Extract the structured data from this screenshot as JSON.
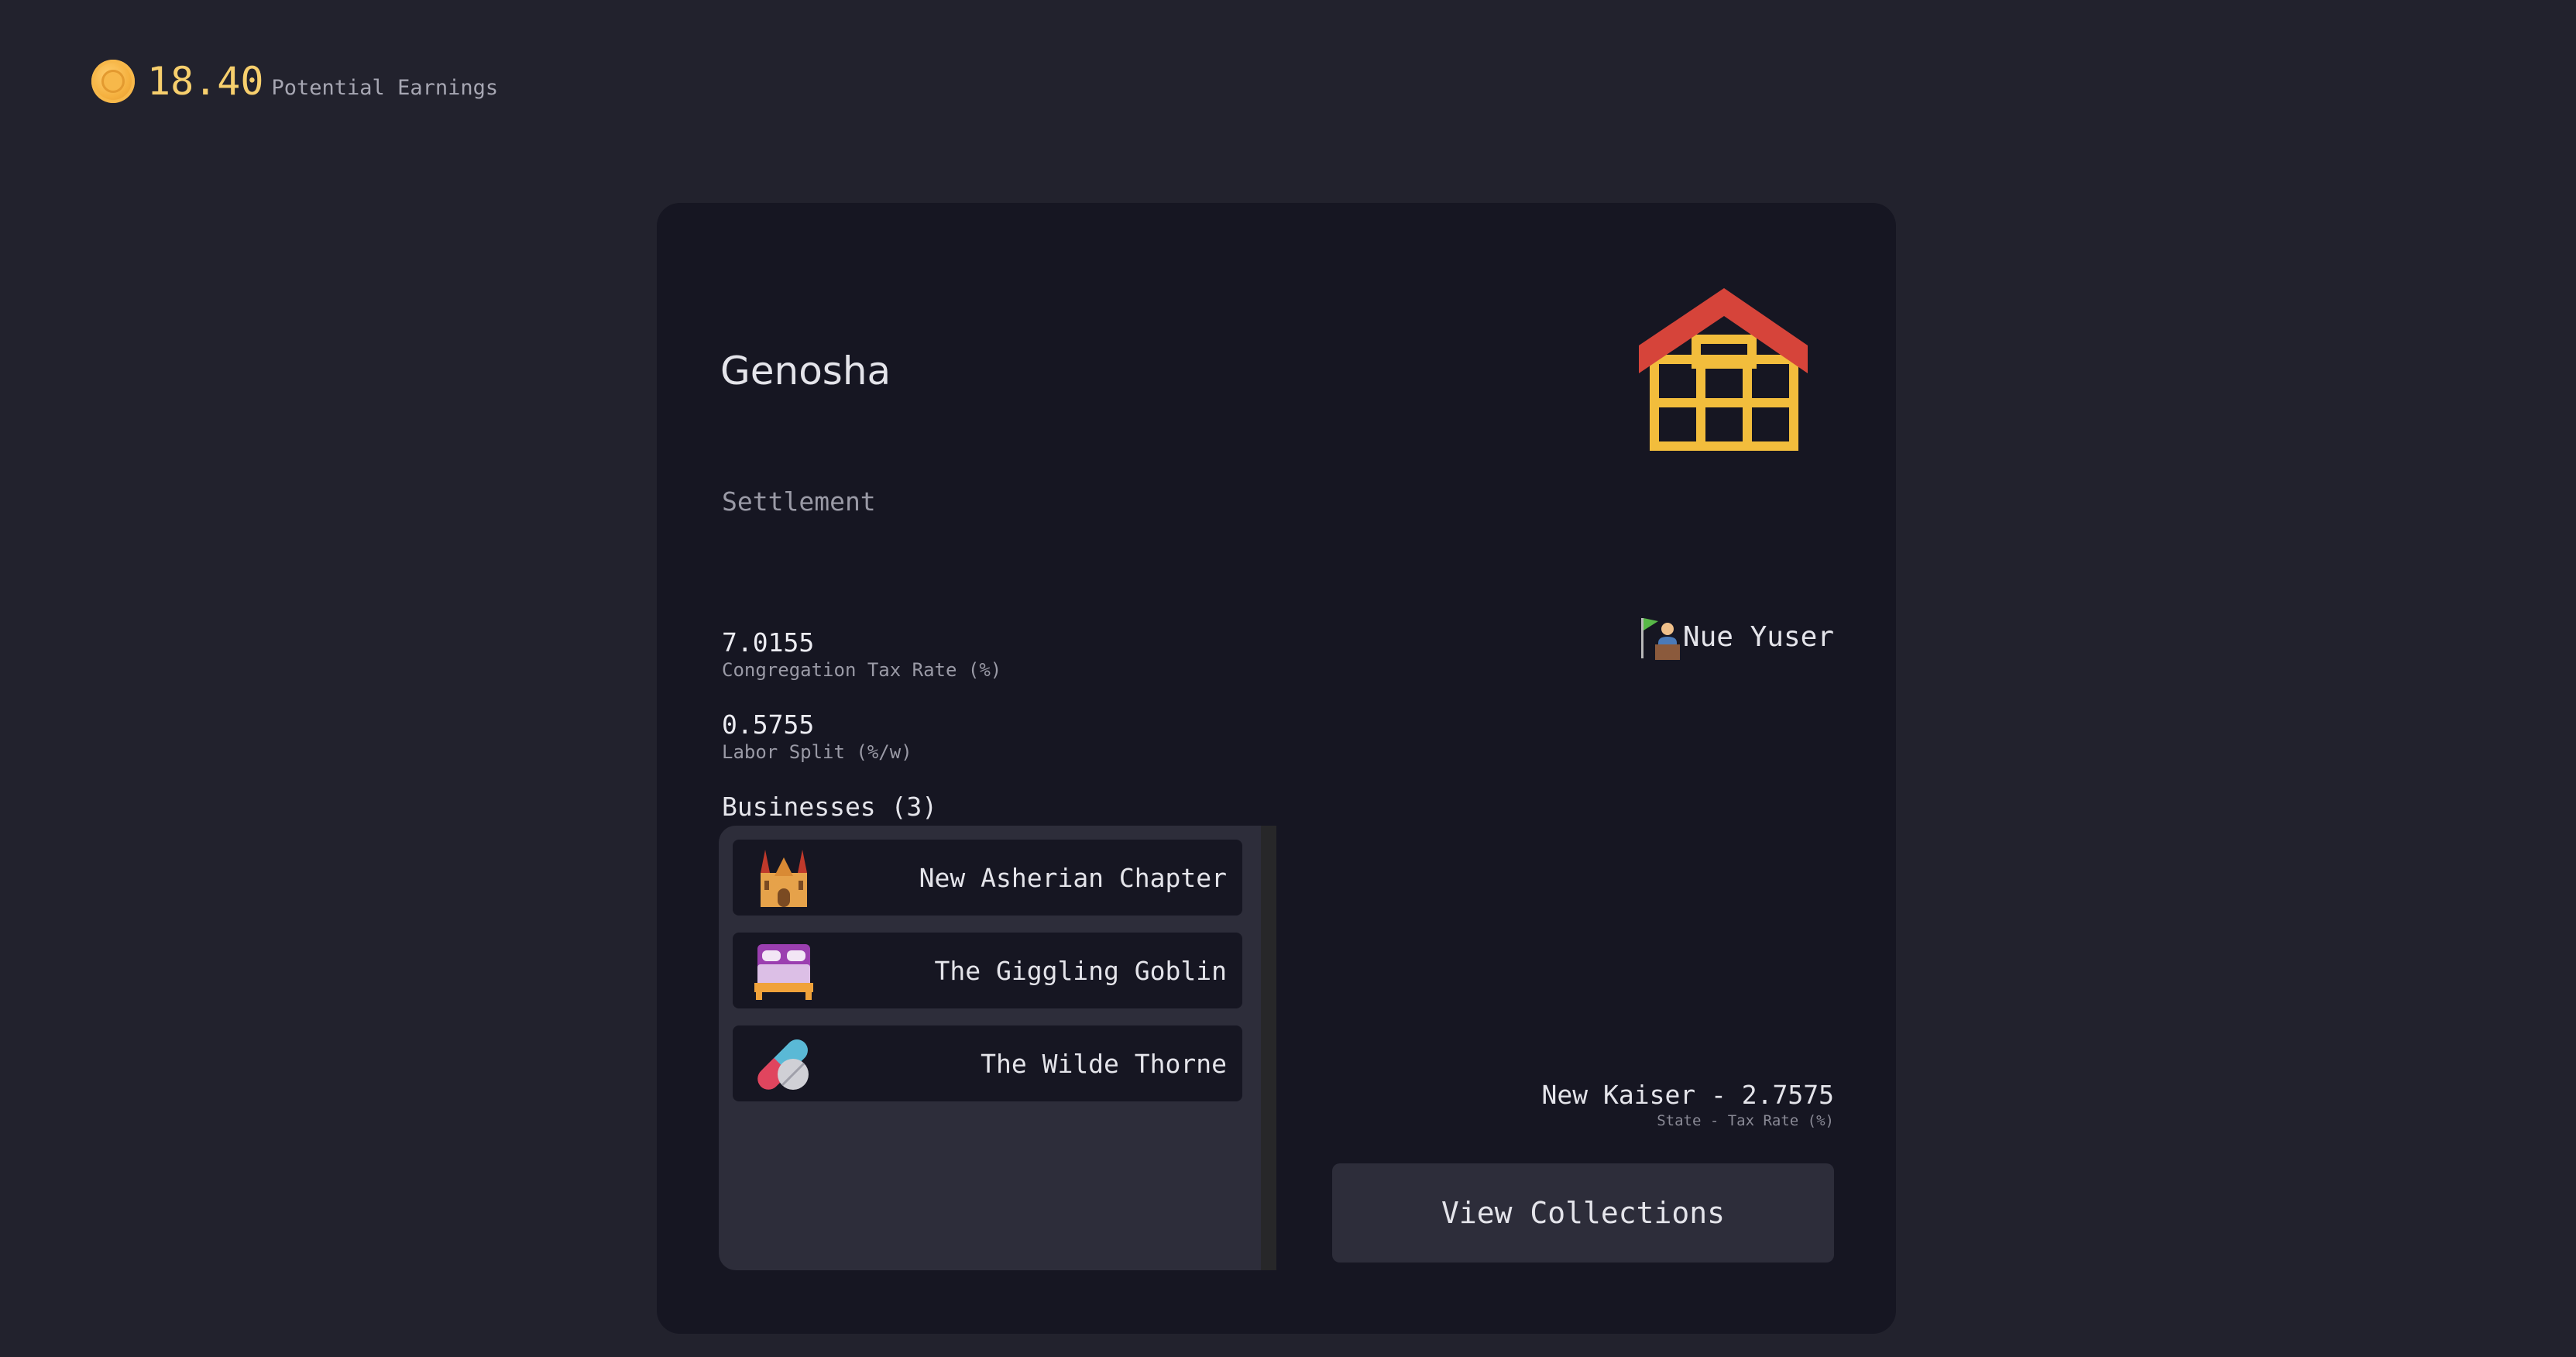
{
  "header": {
    "earnings_value": "18.40",
    "earnings_label": "Potential Earnings",
    "coin_icon": "coin-icon"
  },
  "settlement": {
    "name": "Genosha",
    "type": "Settlement",
    "icon": "barn-house-icon",
    "ruler": {
      "icon": "flag-person-icon",
      "name": "Nue Yuser"
    },
    "stats": [
      {
        "value": "7.0155",
        "label": "Congregation Tax Rate (%)"
      },
      {
        "value": "0.5755",
        "label": "Labor Split (%/w)"
      }
    ],
    "state": {
      "value": "New Kaiser - 2.7575",
      "label": "State - Tax Rate (%)"
    },
    "view_collections_label": "View Collections"
  },
  "businesses": {
    "heading": "Businesses (3)",
    "items": [
      {
        "name": "New Asherian Chapter",
        "icon": "church-icon"
      },
      {
        "name": "The Giggling Goblin",
        "icon": "bed-icon"
      },
      {
        "name": "The Wilde Thorne",
        "icon": "pill-icon"
      }
    ]
  },
  "colors": {
    "background": "#22222d",
    "card": "#161622",
    "accent_gold": "#f7cf6d",
    "panel": "#2d2d3a"
  }
}
